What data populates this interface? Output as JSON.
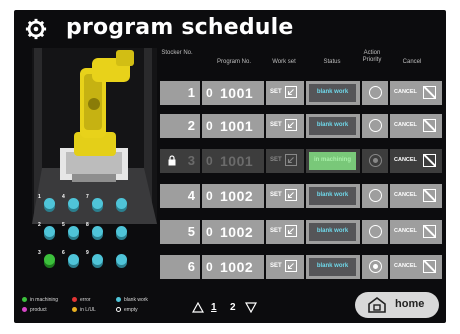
{
  "app": {
    "title": "program schedule"
  },
  "table": {
    "headers": {
      "stocker": "Stocker No.",
      "program": "Program No.",
      "workset": "Work set",
      "status": "Status",
      "action": "Action Priority",
      "cancel": "Cancel"
    },
    "rows": [
      {
        "stocker": "1",
        "prog_zero": "0",
        "program": "1001",
        "set": "SET",
        "status": "blank work",
        "cancel": "CANCEL"
      },
      {
        "stocker": "2",
        "prog_zero": "0",
        "program": "1001",
        "set": "SET",
        "status": "blank work",
        "cancel": "CANCEL"
      },
      {
        "stocker": "3",
        "prog_zero": "0",
        "program": "1001",
        "set": "SET",
        "status": "in machining",
        "cancel": "CANCEL"
      },
      {
        "stocker": "4",
        "prog_zero": "0",
        "program": "1002",
        "set": "SET",
        "status": "blank work",
        "cancel": "CANCEL"
      },
      {
        "stocker": "5",
        "prog_zero": "0",
        "program": "1002",
        "set": "SET",
        "status": "blank work",
        "cancel": "CANCEL"
      },
      {
        "stocker": "6",
        "prog_zero": "0",
        "program": "1002",
        "set": "SET",
        "status": "blank work",
        "cancel": "CANCEL"
      }
    ]
  },
  "stockers": [
    {
      "num": "1",
      "state": "blank-work"
    },
    {
      "num": "4",
      "state": "blank-work"
    },
    {
      "num": "7",
      "state": "blank-work"
    },
    {
      "num": "",
      "state": "blank-work"
    },
    {
      "num": "2",
      "state": "blank-work"
    },
    {
      "num": "5",
      "state": "blank-work"
    },
    {
      "num": "8",
      "state": "blank-work"
    },
    {
      "num": "",
      "state": "blank-work"
    },
    {
      "num": "3",
      "state": "in-machining"
    },
    {
      "num": "6",
      "state": "blank-work"
    },
    {
      "num": "9",
      "state": "blank-work"
    },
    {
      "num": "",
      "state": "blank-work"
    }
  ],
  "legend": {
    "in_machining": "in machining",
    "error": "error",
    "blank_work": "blank work",
    "product": "product",
    "in_lul": "in L/UL",
    "empty": "empty"
  },
  "pager": {
    "page1": "1",
    "page2": "2"
  },
  "home": {
    "label": "home"
  },
  "colors": {
    "in_machining": "#3cc03c",
    "error": "#e23434",
    "blank_work": "#4fc4d8",
    "product": "#d646c6",
    "in_lul": "#e8b020",
    "empty": "#ffffff",
    "robot": "#e8d21a",
    "row_bg": "#9e9e9e",
    "status_active": "#7fe07f"
  },
  "icons": {
    "gear": "gear-icon",
    "lock": "lock-icon",
    "home": "home-icon",
    "prev": "triangle-up-icon",
    "next": "triangle-down-icon"
  }
}
